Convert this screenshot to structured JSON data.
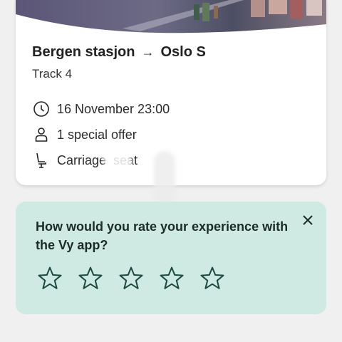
{
  "ticket": {
    "from": "Bergen stasjon",
    "arrow": "→",
    "to": "Oslo S",
    "track": "Track 4",
    "details": [
      {
        "icon": "clock-icon",
        "text": "16 November 23:00"
      },
      {
        "icon": "person-icon",
        "text": "1 special offer"
      },
      {
        "icon": "seat-icon",
        "text": "Carriage  seat"
      }
    ]
  },
  "rating": {
    "question": "How would you rate your experience with the Vy app?",
    "close_icon": "close-icon",
    "stars_total": 5,
    "stars_selected": 0
  },
  "colors": {
    "rating_background": "#cfe9e3",
    "star_outline": "#1b4a40",
    "hero_dark": "#3a3552"
  }
}
